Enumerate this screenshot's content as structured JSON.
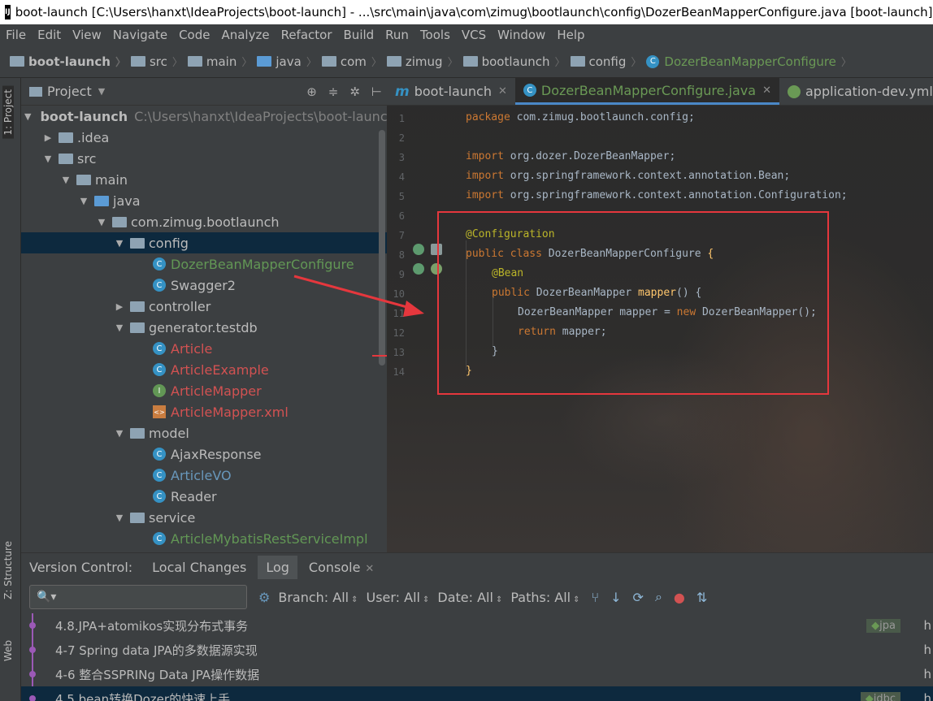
{
  "window": {
    "title": "boot-launch [C:\\Users\\hanxt\\IdeaProjects\\boot-launch] - ...\\src\\main\\java\\com\\zimug\\bootlaunch\\config\\DozerBeanMapperConfigure.java [boot-launch] -"
  },
  "menu": [
    "File",
    "Edit",
    "View",
    "Navigate",
    "Code",
    "Analyze",
    "Refactor",
    "Build",
    "Run",
    "Tools",
    "VCS",
    "Window",
    "Help"
  ],
  "breadcrumb": [
    "boot-launch",
    "src",
    "main",
    "java",
    "com",
    "zimug",
    "bootlaunch",
    "config",
    "DozerBeanMapperConfigure"
  ],
  "stripe": {
    "project_tab": "1: Project",
    "structure_tab": "Z: Structure",
    "web_tab": "Web"
  },
  "project_panel": {
    "title": "Project",
    "tree": [
      {
        "label": "boot-launch",
        "path": "C:\\Users\\hanxt\\IdeaProjects\\boot-launch"
      },
      {
        "label": ".idea"
      },
      {
        "label": "src"
      },
      {
        "label": "main"
      },
      {
        "label": "java"
      },
      {
        "label": "com.zimug.bootlaunch"
      },
      {
        "label": "config"
      },
      {
        "label": "DozerBeanMapperConfigure"
      },
      {
        "label": "Swagger2"
      },
      {
        "label": "controller"
      },
      {
        "label": "generator.testdb"
      },
      {
        "label": "Article"
      },
      {
        "label": "ArticleExample"
      },
      {
        "label": "ArticleMapper"
      },
      {
        "label": "ArticleMapper.xml"
      },
      {
        "label": "model"
      },
      {
        "label": "AjaxResponse"
      },
      {
        "label": "ArticleVO"
      },
      {
        "label": "Reader"
      },
      {
        "label": "service"
      },
      {
        "label": "ArticleMybatisRestServiceImpl"
      }
    ]
  },
  "editor": {
    "tabs": [
      {
        "label": "boot-launch"
      },
      {
        "label": "DozerBeanMapperConfigure.java"
      },
      {
        "label": "application-dev.yml"
      }
    ],
    "line_numbers": [
      "1",
      "2",
      "3",
      "4",
      "5",
      "6",
      "7",
      "8",
      "9",
      "10",
      "11",
      "12",
      "13",
      "14"
    ],
    "code": {
      "l1_kw": "package",
      "l1_rest": " com.zimug.bootlaunch.config;",
      "l3_kw": "import",
      "l3_rest": " org.dozer.DozerBeanMapper;",
      "l4_kw": "import",
      "l4_rest": " org.springframework.context.annotation.Bean;",
      "l5_kw": "import",
      "l5_rest": " org.springframework.context.annotation.Configuration;",
      "l7_ann": "@Configuration",
      "l8_kw": "public class",
      "l8_rest": " DozerBeanMapperConfigure ",
      "l8_brace": "{",
      "l9_ann": "@Bean",
      "l10_kw": "public",
      "l10_type": " DozerBeanMapper ",
      "l10_fn": "mapper",
      "l10_rest": "() {",
      "l11_a": "DozerBeanMapper mapper = ",
      "l11_kw": "new",
      "l11_b": " DozerBeanMapper();",
      "l12_kw": "return",
      "l12_rest": " mapper;",
      "l13": "}",
      "l14": "}"
    }
  },
  "bottom_panel": {
    "tabs": [
      "Version Control:",
      "Local Changes",
      "Log",
      "Console"
    ],
    "filters": [
      "Branch: All",
      "User: All",
      "Date: All",
      "Paths: All"
    ],
    "commits": [
      {
        "message": "4.8.JPA+atomikos实现分布式事务",
        "ref": "jpa",
        "author": "h"
      },
      {
        "message": "4-7 Spring data JPA的多数据源实现",
        "ref": "",
        "author": "h"
      },
      {
        "message": "4-6 整合SSPRINg Data JPA操作数据",
        "ref": "",
        "author": "h"
      },
      {
        "message": "4.5.bean转换Dozer的快速上手",
        "ref": "jdbc",
        "author": "h"
      }
    ]
  },
  "colors": {
    "highlight_box": "#e5373d",
    "arrow": "#e5373d",
    "selection": "#0d293e"
  }
}
